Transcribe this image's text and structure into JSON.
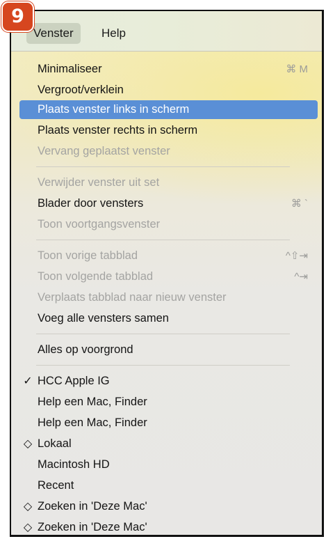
{
  "badge": {
    "label": "9",
    "color": "#d6461f"
  },
  "menubar": {
    "items": [
      {
        "label": "Venster",
        "active": true
      },
      {
        "label": "Help",
        "active": false
      }
    ]
  },
  "menu": {
    "highlight_color": "#5a8fd6",
    "items": [
      {
        "label": "Minimaliseer",
        "shortcut": "⌘ M",
        "state": "enabled"
      },
      {
        "label": "Vergroot/verklein",
        "shortcut": "",
        "state": "enabled"
      },
      {
        "label": "Plaats venster links in scherm",
        "shortcut": "",
        "state": "highlighted"
      },
      {
        "label": "Plaats venster rechts in scherm",
        "shortcut": "",
        "state": "enabled"
      },
      {
        "label": "Vervang geplaatst venster",
        "shortcut": "",
        "state": "disabled"
      },
      {
        "label": "Verwijder venster uit set",
        "shortcut": "",
        "state": "disabled"
      },
      {
        "label": "Blader door vensters",
        "shortcut": "⌘ `",
        "state": "enabled"
      },
      {
        "label": "Toon voortgangsvenster",
        "shortcut": "",
        "state": "disabled"
      },
      {
        "label": "Toon vorige tabblad",
        "shortcut": "^⇧⇥",
        "state": "disabled"
      },
      {
        "label": "Toon volgende tabblad",
        "shortcut": "^⇥",
        "state": "disabled"
      },
      {
        "label": "Verplaats tabblad naar nieuw venster",
        "shortcut": "",
        "state": "disabled"
      },
      {
        "label": "Voeg alle vensters samen",
        "shortcut": "",
        "state": "enabled"
      },
      {
        "label": "Alles op voorgrond",
        "shortcut": "",
        "state": "enabled"
      }
    ],
    "windows": [
      {
        "label": "HCC Apple IG",
        "mark": "✓"
      },
      {
        "label": "Help een Mac, Finder",
        "mark": ""
      },
      {
        "label": "Help een Mac, Finder",
        "mark": ""
      },
      {
        "label": "Lokaal",
        "mark": "◇"
      },
      {
        "label": "Macintosh HD",
        "mark": ""
      },
      {
        "label": "Recent",
        "mark": ""
      },
      {
        "label": "Zoeken in 'Deze Mac'",
        "mark": "◇"
      },
      {
        "label": "Zoeken in 'Deze Mac'",
        "mark": "◇"
      }
    ]
  }
}
